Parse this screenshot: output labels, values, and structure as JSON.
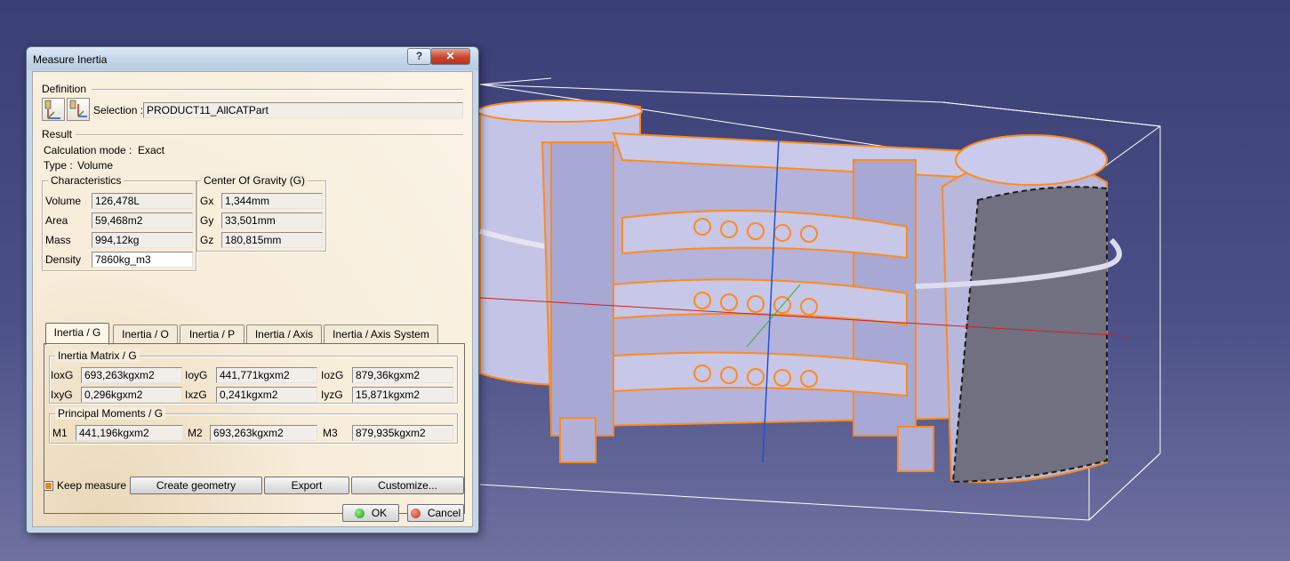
{
  "dialog": {
    "title": "Measure Inertia",
    "help_label": "?",
    "close_label": "✕",
    "definition": {
      "label": "Definition",
      "selection_label": "Selection :",
      "selection_value": "PRODUCT11_AllCATPart"
    },
    "result": {
      "label": "Result",
      "calc_mode_label": "Calculation mode :",
      "calc_mode_value": "Exact",
      "type_label": "Type :",
      "type_value": "Volume"
    },
    "characteristics": {
      "label": "Characteristics",
      "volume_label": "Volume",
      "volume": "126,478L",
      "area_label": "Area",
      "area": "59,468m2",
      "mass_label": "Mass",
      "mass": "994,12kg",
      "density_label": "Density",
      "density": "7860kg_m3"
    },
    "cog": {
      "label": "Center Of Gravity (G)",
      "gx_label": "Gx",
      "gx": "1,344mm",
      "gy_label": "Gy",
      "gy": "33,501mm",
      "gz_label": "Gz",
      "gz": "180,815mm"
    },
    "tabs": [
      "Inertia / G",
      "Inertia / O",
      "Inertia / P",
      "Inertia / Axis",
      "Inertia / Axis System"
    ],
    "inertia_matrix": {
      "label": "Inertia Matrix / G",
      "ioxg_label": "IoxG",
      "ioxg": "693,263kgxm2",
      "ioyg_label": "IoyG",
      "ioyg": "441,771kgxm2",
      "iozg_label": "IozG",
      "iozg": "879,36kgxm2",
      "ixyg_label": "IxyG",
      "ixyg": "0,296kgxm2",
      "ixzg_label": "IxzG",
      "ixzg": "0,241kgxm2",
      "iyzg_label": "IyzG",
      "iyzg": "15,871kgxm2"
    },
    "principal_moments": {
      "label": "Principal Moments / G",
      "m1_label": "M1",
      "m1": "441,196kgxm2",
      "m2_label": "M2",
      "m2": "693,263kgxm2",
      "m3_label": "M3",
      "m3": "879,935kgxm2"
    },
    "keep_measure_label": "Keep measure",
    "create_geometry_label": "Create geometry",
    "export_label": "Export",
    "customize_label": "Customize...",
    "ok_label": "OK",
    "cancel_label": "Cancel"
  },
  "colors": {
    "background_top": "#3a3f76",
    "highlight_orange": "#ff8a1e",
    "part_fill": "#b8b8dc",
    "dialog_bg": "#faf3e6"
  }
}
